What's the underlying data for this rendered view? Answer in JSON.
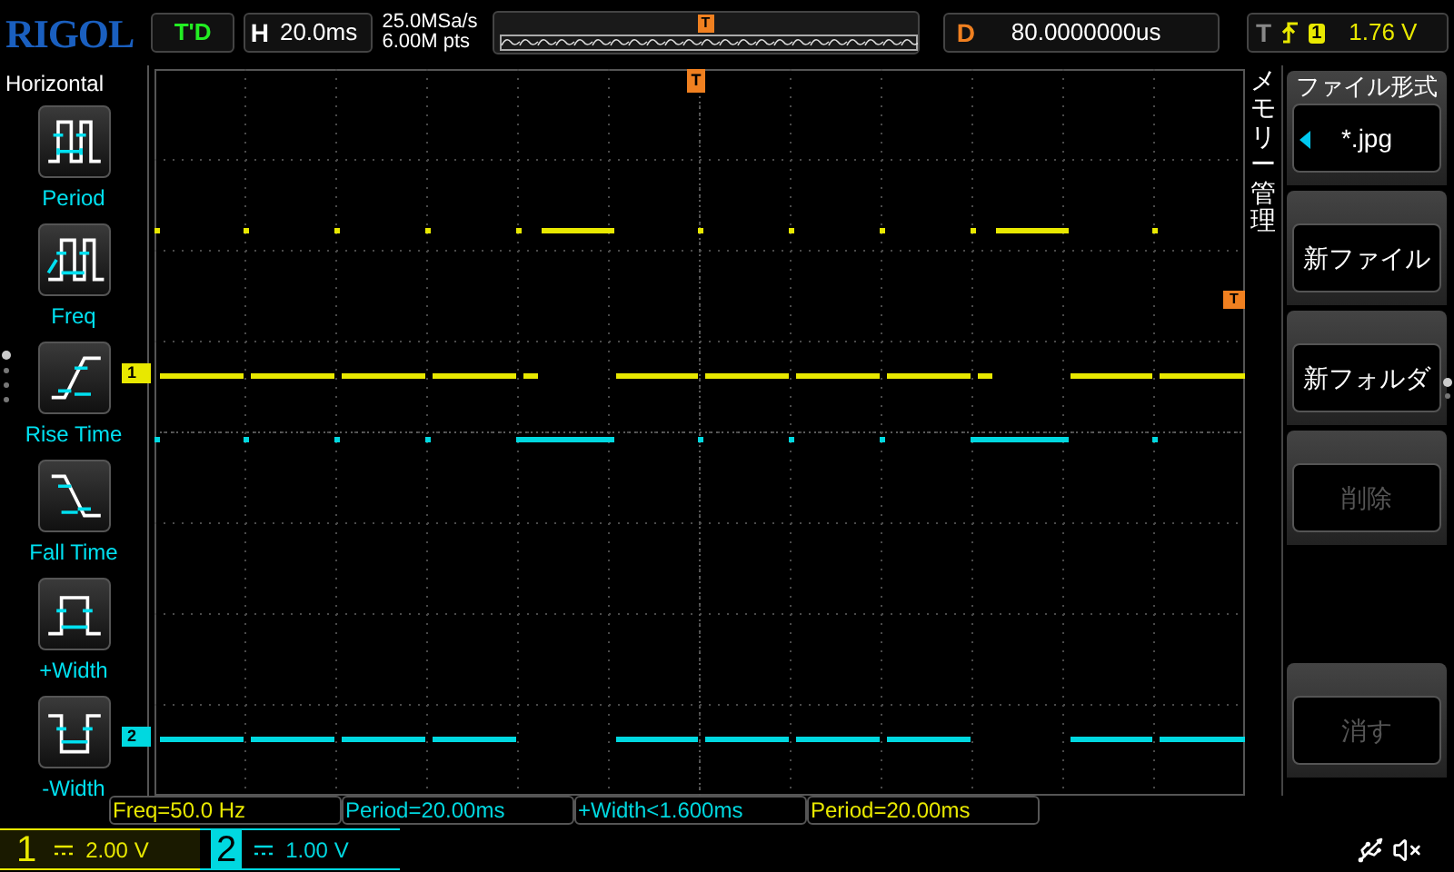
{
  "header": {
    "logo": "RIGOL",
    "status": "T'D",
    "timebase": {
      "label": "H",
      "value": "20.0ms"
    },
    "sample_rate": "25.0MSa/s",
    "memory_depth": "6.00M pts",
    "overview_marker": "T",
    "delay": {
      "label": "D",
      "value": "80.0000000us"
    },
    "trigger": {
      "label": "T",
      "source": "1",
      "level": "1.76 V"
    }
  },
  "sidebar": {
    "title": "Horizontal",
    "items": [
      {
        "label": "Period",
        "kind": "period"
      },
      {
        "label": "Freq",
        "kind": "freq"
      },
      {
        "label": "Rise Time",
        "kind": "rise"
      },
      {
        "label": "Fall Time",
        "kind": "fall"
      },
      {
        "label": "+Width",
        "kind": "pwidth"
      },
      {
        "label": "-Width",
        "kind": "nwidth"
      }
    ]
  },
  "plot": {
    "trigger_position_marker": "T",
    "trigger_level_marker": "T",
    "channel_markers": [
      {
        "label": "1",
        "color": "#e8e800"
      },
      {
        "label": "2",
        "color": "#00d8e0"
      }
    ]
  },
  "menu": {
    "title": "メモリー管理",
    "items": [
      {
        "header": "ファイル形式",
        "label": "*.jpg",
        "disabled": false
      },
      {
        "label": "新ファイル",
        "disabled": false
      },
      {
        "label": "新フォルダ",
        "disabled": false
      },
      {
        "label": "削除",
        "disabled": true
      },
      {
        "label": "消す",
        "disabled": true
      }
    ]
  },
  "measurements": [
    {
      "text": "Freq=50.0 Hz",
      "kind": "ch1"
    },
    {
      "text": "Period=20.00ms",
      "kind": "ch2"
    },
    {
      "text": "+Width<1.600ms",
      "kind": "ch2"
    },
    {
      "text": "Period=20.00ms",
      "kind": "ch1"
    }
  ],
  "channels": [
    {
      "number": "1",
      "scale": "2.00 V",
      "color": "#e8e800",
      "selected": false
    },
    {
      "number": "2",
      "scale": "1.00 V",
      "color": "#00d8e0",
      "selected": true
    }
  ]
}
